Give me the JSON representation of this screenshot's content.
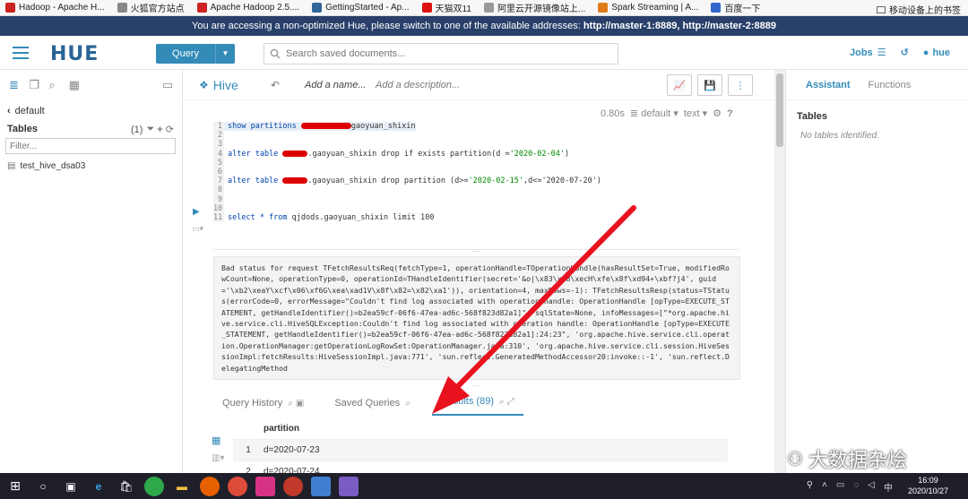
{
  "bookmarks": [
    {
      "label": "Hadoop - Apache H...",
      "color": "#cc2222"
    },
    {
      "label": "火狐官方站点",
      "color": "#888888"
    },
    {
      "label": "Apache Hadoop 2.5....",
      "color": "#cc2222"
    },
    {
      "label": "GettingStarted - Ap...",
      "color": "#336699"
    },
    {
      "label": "天猫双11",
      "color": "#dd1111"
    },
    {
      "label": "阿里云开源镜像站上...",
      "color": "#999999"
    },
    {
      "label": "Spark Streaming | A...",
      "color": "#e07b1a"
    },
    {
      "label": "百度一下",
      "color": "#3366cc"
    }
  ],
  "bookmarks_right": "移动设备上的书签",
  "banner": {
    "text": "You are accessing a non-optimized Hue, please switch to one of the available addresses: ",
    "links": "http://master-1:8889, http://master-2:8889"
  },
  "navbar": {
    "logo": "HUE",
    "query_label": "Query",
    "search_placeholder": "Search saved documents...",
    "jobs_label": "Jobs",
    "user_label": "hue"
  },
  "left": {
    "database": "default",
    "tables_label": "Tables",
    "tables_count": "(1)",
    "filter_placeholder": "Filter...",
    "table_items": [
      "test_hive_dsa03"
    ]
  },
  "editor": {
    "title": "Hive",
    "add_name": "Add a name...",
    "add_description": "Add a description...",
    "exec_time": "0.80s",
    "database": "default",
    "format": "text",
    "code_lines": [
      {
        "n": "1",
        "pre": "",
        "kw": "show partitions ",
        "redact": 56,
        "rest": "gaoyuan_shixin",
        "str": "",
        "post": ""
      },
      {
        "n": "2",
        "pre": "",
        "kw": "",
        "redact": 0,
        "rest": "",
        "str": "",
        "post": ""
      },
      {
        "n": "3",
        "pre": "",
        "kw": "",
        "redact": 0,
        "rest": "",
        "str": "",
        "post": ""
      },
      {
        "n": "4",
        "pre": "",
        "kw": "alter table ",
        "redact": 28,
        "rest": ".gaoyuan_shixin drop if exists partition(d =",
        "str": "'2020-02-04'",
        "post": ")"
      },
      {
        "n": "5",
        "pre": "",
        "kw": "",
        "redact": 0,
        "rest": "",
        "str": "",
        "post": ""
      },
      {
        "n": "6",
        "pre": "",
        "kw": "",
        "redact": 0,
        "rest": "",
        "str": "",
        "post": ""
      },
      {
        "n": "7",
        "pre": "",
        "kw": "alter table ",
        "redact": 28,
        "rest": ".gaoyuan_shixin drop partition (d>=",
        "str": "'2020-02-15'",
        "post": ",d<='2020-07-20')"
      },
      {
        "n": "8",
        "pre": "",
        "kw": "",
        "redact": 0,
        "rest": "",
        "str": "",
        "post": ""
      },
      {
        "n": "9",
        "pre": "",
        "kw": "",
        "redact": 0,
        "rest": "",
        "str": "",
        "post": ""
      },
      {
        "n": "10",
        "pre": "",
        "kw": "",
        "redact": 0,
        "rest": "",
        "str": "",
        "post": ""
      },
      {
        "n": "11",
        "pre": "",
        "kw": "select * from ",
        "redact": 0,
        "rest": "qjdods.gaoyuan_shixin limit ",
        "str": "",
        "post": "100"
      }
    ],
    "error_text": "Bad status for request TFetchResultsReq(fetchType=1, operationHandle=TOperationHandle(hasResultSet=True, modifiedRowCount=None, operationType=0, operationId=THandleIdentifier(secret='&o|\\x83\\xd8\\xecH\\xfe\\x8f\\xd94+\\xbf?j4', guid='\\xb2\\xeaY\\xcf\\x06\\xf6G\\xea\\xad1V\\x8f\\x82=\\x82\\xa1')), orientation=4, maxRows=-1): TFetchResultsResp(status=TStatus(errorCode=0, errorMessage=\"Couldn't find log associated with operation handle: OperationHandle [opType=EXECUTE_STATEMENT, getHandleIdentifier()=b2ea59cf-06f6-47ea-ad6c-568f823d82a1]\", sqlState=None, infoMessages=[\"*org.apache.hive.service.cli.HiveSQLException:Couldn't find log associated with operation handle: OperationHandle [opType=EXECUTE_STATEMENT, getHandleIdentifier()=b2ea59cf-06f6-47ea-ad6c-568f823d82a1]:24:23\", 'org.apache.hive.service.cli.operation.OperationManager:getOperationLogRowSet:OperationManager.java:310', 'org.apache.hive.service.cli.session.HiveSessionImpl:fetchResults:HiveSessionImpl.java:771', 'sun.reflect.GeneratedMethodAccessor20:invoke::-1', 'sun.reflect.DelegatingMethod"
  },
  "result_tabs": [
    {
      "label": "Query History",
      "active": false
    },
    {
      "label": "Saved Queries",
      "active": false
    },
    {
      "label": "Results (89)",
      "active": true
    }
  ],
  "results": {
    "column": "partition",
    "rows": [
      {
        "idx": "1",
        "value": "d=2020-07-23"
      },
      {
        "idx": "2",
        "value": "d=2020-07-24"
      }
    ]
  },
  "assistant": {
    "tab_assistant": "Assistant",
    "tab_functions": "Functions",
    "tables_label": "Tables",
    "empty_text": "No tables identified."
  },
  "watermark": "大数据杂烩",
  "taskbar": {
    "time": "16:09",
    "date": "2020/10/27"
  },
  "colors": {
    "accent": "#338bb8",
    "banner": "#29406a",
    "arrow": "#e8121f"
  }
}
